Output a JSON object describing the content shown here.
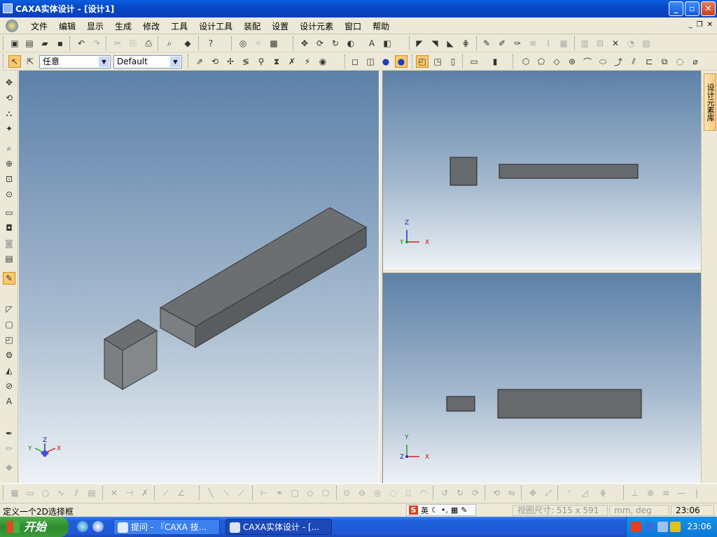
{
  "window": {
    "title": "CAXA实体设计 - [设计1]",
    "btn_min": "_",
    "btn_max": "▫",
    "btn_close": "✕"
  },
  "menubar": {
    "items": [
      "文件",
      "编辑",
      "显示",
      "生成",
      "修改",
      "工具",
      "设计工具",
      "装配",
      "设置",
      "设计元素",
      "窗口",
      "帮助"
    ],
    "mdi_min": "_",
    "mdi_restore": "❐",
    "mdi_close": "✕"
  },
  "toolbar2": {
    "filter_select": "任意",
    "style_select": "Default"
  },
  "viewports": {
    "main": {
      "axis_z": "Z",
      "axis_y": "Y",
      "axis_x": "X"
    },
    "top": {
      "axis_z": "Z",
      "axis_y": "Y",
      "axis_x": "X"
    },
    "front": {
      "axis_y": "Y",
      "axis_z": "Z",
      "axis_x": "X"
    }
  },
  "side_panel": {
    "tab_label": "设计元素库"
  },
  "statusbar": {
    "message": "定义一个2D选择框",
    "ime_label": "英",
    "view_size": "视图尺寸: 515 x 591",
    "units": "mm, deg",
    "time": "23:06"
  },
  "taskbar": {
    "start_label": "开始",
    "tasks": [
      {
        "label": "提问 - 『CAXA 技..."
      },
      {
        "label": "CAXA实体设计 - [..."
      }
    ],
    "clock": "23:06"
  },
  "colors": {
    "titlebar": "#0a48c8",
    "viewport_top": "#5c80a8",
    "viewport_bottom": "#eef2f6",
    "solid_face": "#6b6e70",
    "taskbar": "#2258d8"
  }
}
